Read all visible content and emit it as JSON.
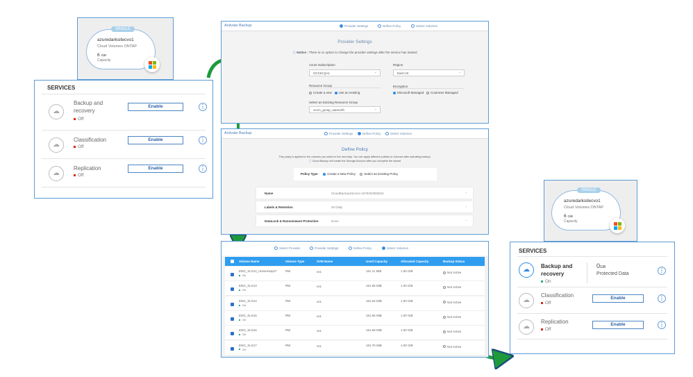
{
  "card": {
    "badge": "SINGLE",
    "name": "azuredarksitecvo1",
    "type": "Cloud Volumes ONTAP",
    "capacity": "6",
    "capacity_unit": "GiB",
    "capacity_label": "Capacity"
  },
  "services_before": {
    "title": "SERVICES",
    "items": [
      {
        "icon": "backup-icon",
        "name": "Backup and recovery",
        "status": "Off",
        "button": "Enable"
      },
      {
        "icon": "classification-icon",
        "name": "Classification",
        "status": "Off",
        "button": "Enable"
      },
      {
        "icon": "replication-icon",
        "name": "Replication",
        "status": "Off",
        "button": "Enable"
      }
    ]
  },
  "services_after": {
    "title": "SERVICES",
    "backup": {
      "name": "Backup and recovery",
      "status": "On",
      "protected_value": "0",
      "protected_unit": "GiB",
      "protected_label": "Protected Data"
    },
    "items": [
      {
        "icon": "classification-icon",
        "name": "Classification",
        "status": "Off",
        "button": "Enable"
      },
      {
        "icon": "replication-icon",
        "name": "Replication",
        "status": "Off",
        "button": "Enable"
      }
    ]
  },
  "wizard": {
    "title": "Activate Backup",
    "steps": [
      "Provider Settings",
      "Define Policy",
      "Select Volumes"
    ]
  },
  "provider": {
    "heading": "Provider Settings",
    "notice_bold": "Notice :",
    "notice": " There is no option to change the provider settings after the service has started",
    "subscription_label": "Azure Subscription",
    "subscription": "OCCM QA1",
    "region_label": "Region",
    "region": "East US",
    "rg_label": "Resource Group",
    "rg_new": "Create a new",
    "rg_existing": "Use an existing",
    "enc_label": "Encryption",
    "enc_ms": "Microsoft Managed",
    "enc_cust": "Customer Managed",
    "existing_label": "Select an Existing Resource Group",
    "existing": "occm_group_uaenorth"
  },
  "policy": {
    "heading": "Define Policy",
    "desc": "This policy is applied to the volumes you select in the next step. You can apply different policies to volumes after activating backup.",
    "info": "Cloud Backup will create the Storage Account after you complete the wizard",
    "type_label": "Policy Type",
    "type_new": "Create a New Policy",
    "type_existing": "Select an Existing Policy",
    "rows": [
      {
        "label": "Name",
        "value": "CloudBackupService-1678252865522"
      },
      {
        "label": "Labels & Retention",
        "value": "30 Daily"
      },
      {
        "label": "DataLock & Ransomware Protection",
        "value": "None"
      }
    ]
  },
  "volumes": {
    "steps": [
      "Select Provider",
      "Provider Settings",
      "Define Policy",
      "Select Volumes"
    ],
    "columns": [
      "Volume Name",
      "Volume Type",
      "SVM Name",
      "Used Capacity",
      "Allocated Capacity",
      "Backup Status"
    ],
    "rows": [
      {
        "name": "ENG_XLS12_restoresep27",
        "state": "On",
        "type": "RW",
        "svm": "vs1",
        "used": "161.11 MiB",
        "alloc": "1.00 GiB",
        "status": "Not Active"
      },
      {
        "name": "ENG_XLS13",
        "state": "On",
        "type": "RW",
        "svm": "vs1",
        "used": "161.65 MiB",
        "alloc": "1.00 GiB",
        "status": "Not Active"
      },
      {
        "name": "ENG_XLS14",
        "state": "On",
        "type": "RW",
        "svm": "vs1",
        "used": "161.62 MiB",
        "alloc": "1.00 GiB",
        "status": "Not Active"
      },
      {
        "name": "ENG_XLS15",
        "state": "On",
        "type": "RW",
        "svm": "vs1",
        "used": "161.65 MiB",
        "alloc": "1.00 GiB",
        "status": "Not Active"
      },
      {
        "name": "ENG_XLS16",
        "state": "On",
        "type": "RW",
        "svm": "vs1",
        "used": "161.69 MiB",
        "alloc": "1.00 GiB",
        "status": "Not Active"
      },
      {
        "name": "ENG_XLS17",
        "state": "On",
        "type": "RW",
        "svm": "vs1",
        "used": "161.70 MiB",
        "alloc": "1.00 GiB",
        "status": "Not Active"
      }
    ]
  },
  "colors": {
    "accent": "#2e9df0",
    "frame": "#5b9bd5",
    "arrow": "#1e9a3c",
    "off": "#d9261c",
    "on": "#22b07d"
  }
}
